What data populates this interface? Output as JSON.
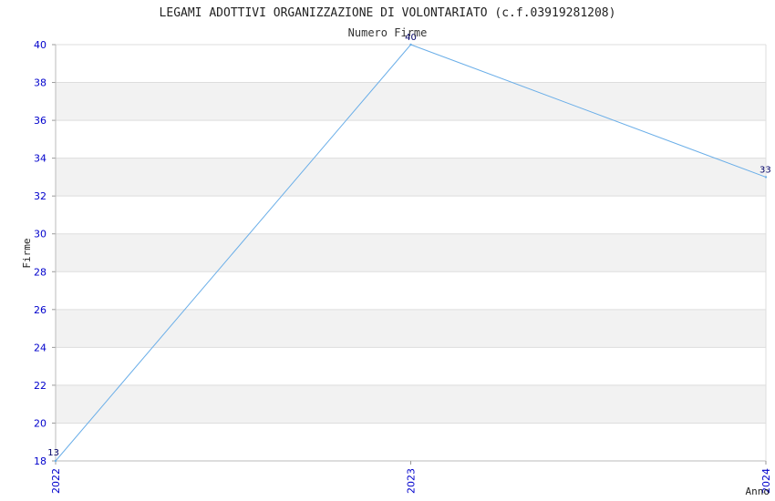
{
  "chart_data": {
    "type": "line",
    "title": "LEGAMI ADOTTIVI ORGANIZZAZIONE DI VOLONTARIATO (c.f.03919281208)",
    "subtitle": "Numero Firme",
    "xlabel": "Anno",
    "ylabel": "Firme",
    "categories": [
      "2022",
      "2023",
      "2024"
    ],
    "series": [
      {
        "values": [
          18,
          40,
          33
        ],
        "labels": [
          "13",
          "40",
          "33"
        ]
      }
    ],
    "ylim": [
      18,
      40
    ],
    "yticks": [
      "18",
      "20",
      "22",
      "24",
      "26",
      "28",
      "30",
      "32",
      "34",
      "36",
      "38",
      "40"
    ],
    "grid": true,
    "line_color": "#6aaee8",
    "band_colors": [
      "#ffffff",
      "#f2f2f2"
    ],
    "tick_color": "#0000cc"
  }
}
